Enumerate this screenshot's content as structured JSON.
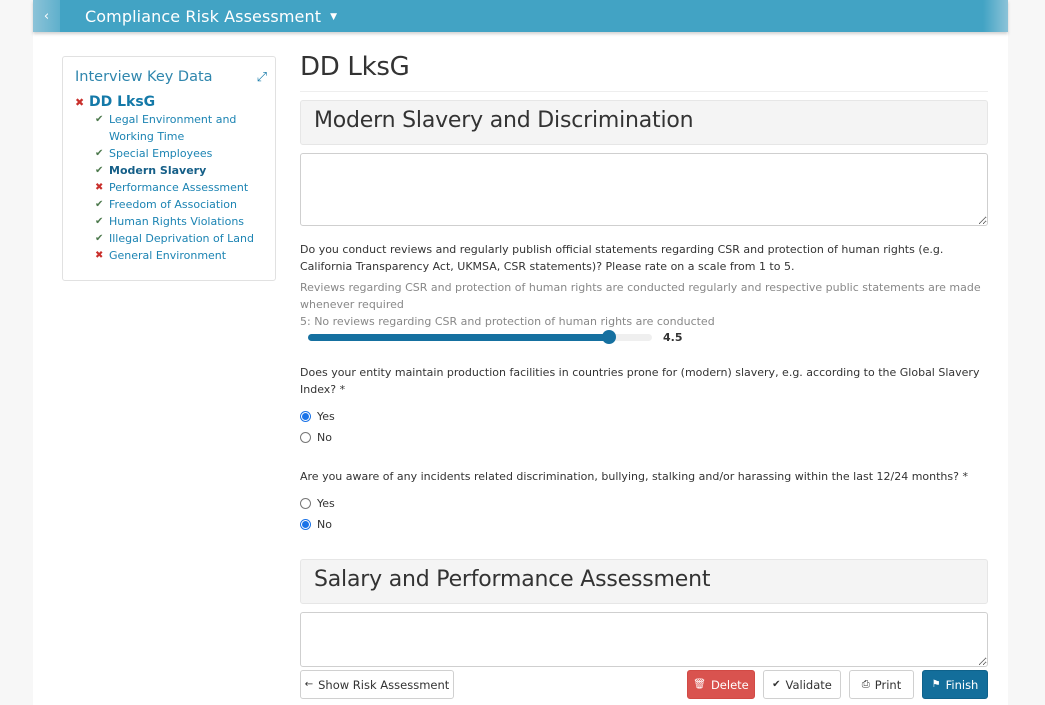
{
  "header": {
    "back_icon": "chevron-left-icon",
    "title": "Compliance Risk Assessment",
    "dropdown_icon": "caret-down-icon",
    "back_glyph": "‹",
    "caret_glyph": "▼"
  },
  "sidebar": {
    "title": "Interview Key Data",
    "expand_icon": "expand-icon",
    "expand_glyph": "⤢",
    "root": {
      "label": "DD LksG",
      "status": "incomplete",
      "glyph": "✖"
    },
    "items": [
      {
        "label": "Legal Environment and Working Time",
        "status": "complete",
        "glyph": "✔",
        "active": false
      },
      {
        "label": "Special Employees",
        "status": "complete",
        "glyph": "✔",
        "active": false
      },
      {
        "label": "Modern Slavery",
        "status": "complete",
        "glyph": "✔",
        "active": true
      },
      {
        "label": "Performance Assessment",
        "status": "incomplete",
        "glyph": "✖",
        "active": false
      },
      {
        "label": "Freedom of Association",
        "status": "complete",
        "glyph": "✔",
        "active": false
      },
      {
        "label": "Human Rights Violations",
        "status": "complete",
        "glyph": "✔",
        "active": false
      },
      {
        "label": "Illegal Deprivation of Land",
        "status": "complete",
        "glyph": "✔",
        "active": false
      },
      {
        "label": "General Environment",
        "status": "incomplete",
        "glyph": "✖",
        "active": false
      }
    ]
  },
  "main": {
    "page_title": "DD LksG",
    "sections": [
      {
        "title": "Modern Slavery and Discrimination",
        "comment_value": "",
        "questions": [
          {
            "type": "slider",
            "text": "Do you conduct reviews and regularly publish official statements regarding CSR and protection of human rights (e.g. California Transparency Act, UKMSA, CSR statements)? Please rate on a scale from 1 to 5.",
            "hint_low": "Reviews regarding CSR and protection of human rights are conducted regularly and respective public statements are made whenever required",
            "hint_high": "5: No reviews regarding CSR and protection of human rights are conducted",
            "min": 1,
            "max": 5,
            "value": 4.5,
            "value_label": "4.5"
          },
          {
            "type": "radio",
            "text": "Does your entity maintain production facilities in countries prone for (modern) slavery, e.g. according to the Global Slavery Index? *",
            "options": [
              "Yes",
              "No"
            ],
            "selected": "Yes"
          },
          {
            "type": "radio",
            "text": "Are you aware of any incidents related discrimination, bullying, stalking and/or harassing within the last 12/24 months? *",
            "options": [
              "Yes",
              "No"
            ],
            "selected": "No"
          }
        ]
      },
      {
        "title": "Salary and Performance Assessment",
        "comment_value": ""
      }
    ]
  },
  "actions": {
    "show_risk": {
      "label": "Show Risk Assessment",
      "icon": "arrow-left-icon",
      "glyph": "🡐"
    },
    "delete": {
      "label": "Delete",
      "icon": "trash-icon",
      "glyph": "🗑"
    },
    "validate": {
      "label": "Validate",
      "icon": "check-icon",
      "glyph": "✔"
    },
    "print": {
      "label": "Print",
      "icon": "print-icon",
      "glyph": "⎙"
    },
    "finish": {
      "label": "Finish",
      "icon": "flag-icon",
      "glyph": "⚑"
    }
  },
  "colors": {
    "header_bg": "#42a3c4",
    "link_blue": "#1c84b3",
    "slider_fill": "#1570a0",
    "delete_red": "#d9534f",
    "finish_blue": "#136e9b",
    "ok_green": "#4e7a4e",
    "error_red": "#c9302c"
  }
}
